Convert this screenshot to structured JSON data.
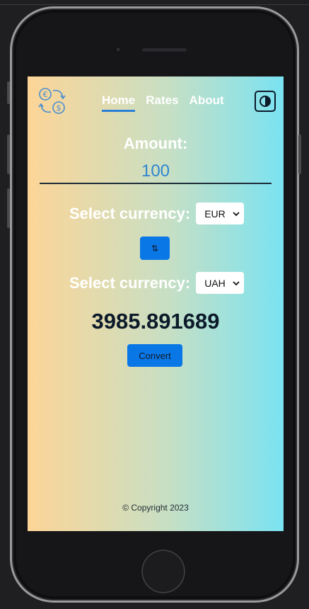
{
  "header": {
    "logo_icon": "currency-exchange-icon",
    "nav": [
      {
        "label": "Home",
        "active": true
      },
      {
        "label": "Rates",
        "active": false
      },
      {
        "label": "About",
        "active": false
      }
    ],
    "theme_icon": "contrast-icon"
  },
  "converter": {
    "amount_label": "Amount:",
    "amount_value": "100",
    "from_label": "Select currency:",
    "from_currency": "EUR",
    "swap_label": "⇅",
    "to_label": "Select currency:",
    "to_currency": "UAH",
    "result": "3985.891689",
    "convert_label": "Convert"
  },
  "footer": {
    "copyright": "© Copyright 2023"
  },
  "colors": {
    "gradient_start": "#fdd597",
    "gradient_end": "#7ae3f2",
    "accent": "#0a77e6"
  }
}
